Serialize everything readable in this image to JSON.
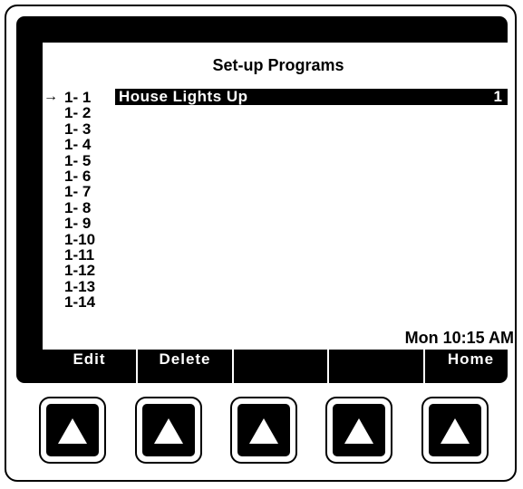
{
  "screen": {
    "title": "Set-up Programs",
    "cursor_glyph": "→",
    "programs": [
      "1- 1",
      "1- 2",
      "1- 3",
      "1- 4",
      "1- 5",
      "1- 6",
      "1- 7",
      "1- 8",
      "1- 9",
      "1-10",
      "1-11",
      "1-12",
      "1-13",
      "1-14"
    ],
    "selected": {
      "name": "House Lights Up",
      "value": "1"
    },
    "clock": "Mon 10:15 AM"
  },
  "softkeys": [
    "Edit",
    "Delete",
    "",
    "",
    "Home"
  ],
  "hardware_buttons": [
    "up-arrow-icon",
    "up-arrow-icon",
    "up-arrow-icon",
    "up-arrow-icon",
    "up-arrow-icon"
  ]
}
